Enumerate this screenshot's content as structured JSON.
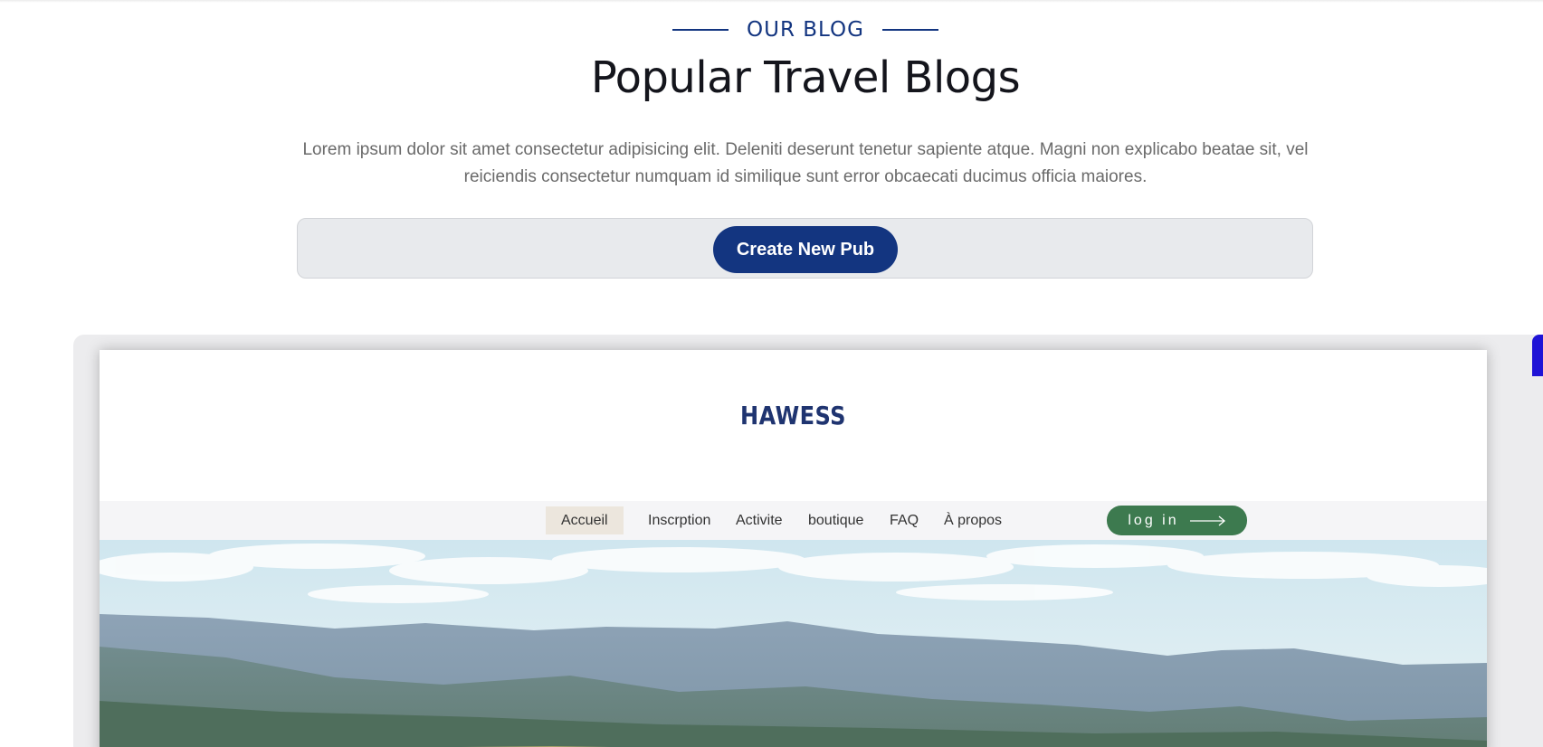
{
  "section": {
    "eyebrow": "OUR BLOG",
    "title": "Popular Travel Blogs",
    "description": "Lorem ipsum dolor sit amet consectetur adipisicing elit. Deleniti deserunt tenetur sapiente atque. Magni non explicabo beatae sit, vel reiciendis consectetur numquam id similique sunt error obcaecati ducimus officia maiores."
  },
  "actions": {
    "create_label": "Create New Pub"
  },
  "preview": {
    "brand": "HAWESS",
    "nav": [
      {
        "label": "Accueil",
        "active": true
      },
      {
        "label": "Inscrption",
        "active": false
      },
      {
        "label": "Activite",
        "active": false
      },
      {
        "label": "boutique",
        "active": false
      },
      {
        "label": "FAQ",
        "active": false
      },
      {
        "label": "À propos",
        "active": false
      }
    ],
    "login_label": "log in",
    "hero_image": "mountain-landscape"
  },
  "colors": {
    "primary": "#133580",
    "login_green": "#3d7a4f",
    "active_nav_bg": "#ece6dd",
    "indicator": "#1f13d6"
  }
}
